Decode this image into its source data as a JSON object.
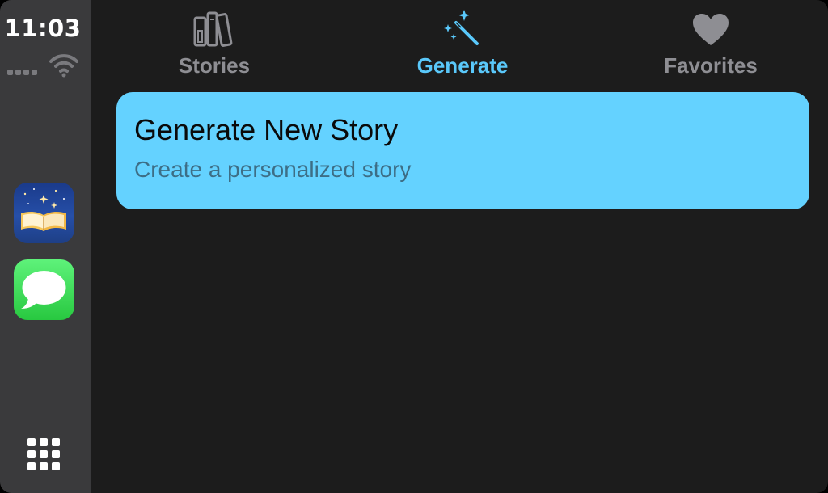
{
  "status_bar": {
    "time": "11:03",
    "signal_bars": 4,
    "wifi": true
  },
  "dock": {
    "apps": [
      {
        "name": "stories-app",
        "icon": "open-book-icon"
      },
      {
        "name": "messages-app",
        "icon": "speech-bubble-icon"
      }
    ],
    "app_grid_icon": "app-grid-icon"
  },
  "tabs": [
    {
      "label": "Stories",
      "icon": "bookshelf-icon",
      "selected": false
    },
    {
      "label": "Generate",
      "icon": "magic-wand-icon",
      "selected": true
    },
    {
      "label": "Favorites",
      "icon": "heart-icon",
      "selected": false
    }
  ],
  "list": {
    "items": [
      {
        "title": "Generate New Story",
        "subtitle": "Create a personalized story"
      }
    ]
  },
  "colors": {
    "accent": "#5ac8fa",
    "card_background": "#64d2ff",
    "inactive_tab": "#8e8e93",
    "background": "#1c1c1c",
    "dock_background": "#3a3a3c"
  }
}
